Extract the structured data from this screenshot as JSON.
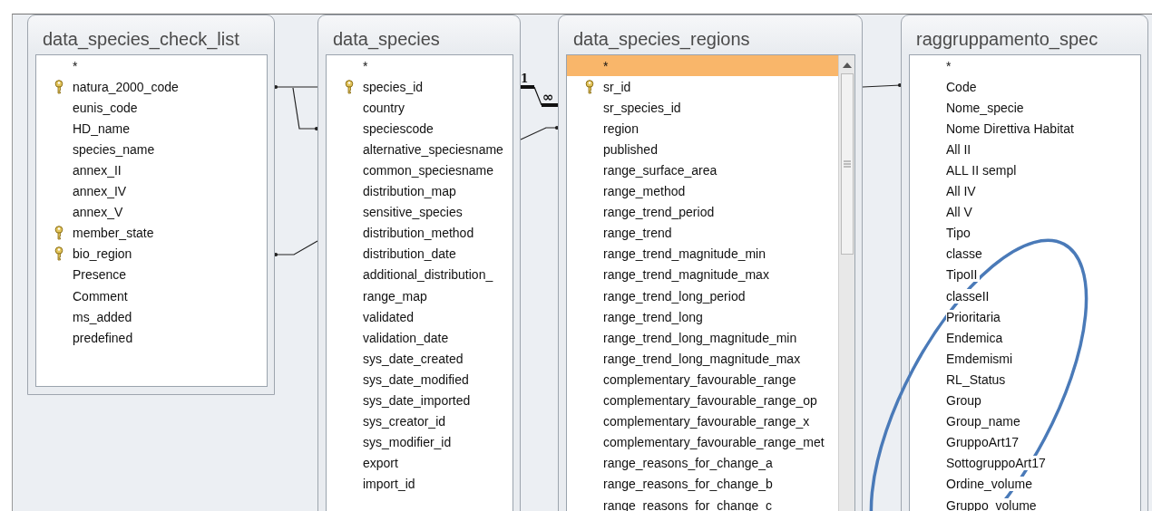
{
  "tables": [
    {
      "title": "data_species_check_list",
      "fields": [
        {
          "name": "*",
          "key": false,
          "selected": false
        },
        {
          "name": "natura_2000_code",
          "key": true,
          "selected": false
        },
        {
          "name": "eunis_code",
          "key": false,
          "selected": false
        },
        {
          "name": "HD_name",
          "key": false,
          "selected": false
        },
        {
          "name": "species_name",
          "key": false,
          "selected": false
        },
        {
          "name": "annex_II",
          "key": false,
          "selected": false
        },
        {
          "name": "annex_IV",
          "key": false,
          "selected": false
        },
        {
          "name": "annex_V",
          "key": false,
          "selected": false
        },
        {
          "name": "member_state",
          "key": true,
          "selected": false
        },
        {
          "name": "bio_region",
          "key": true,
          "selected": false
        },
        {
          "name": "Presence",
          "key": false,
          "selected": false
        },
        {
          "name": "Comment",
          "key": false,
          "selected": false
        },
        {
          "name": "ms_added",
          "key": false,
          "selected": false
        },
        {
          "name": "predefined",
          "key": false,
          "selected": false
        }
      ]
    },
    {
      "title": "data_species",
      "fields": [
        {
          "name": "*",
          "key": false,
          "selected": false
        },
        {
          "name": "species_id",
          "key": true,
          "selected": false
        },
        {
          "name": "country",
          "key": false,
          "selected": false
        },
        {
          "name": "speciescode",
          "key": false,
          "selected": false
        },
        {
          "name": "alternative_speciesname",
          "key": false,
          "selected": false
        },
        {
          "name": "common_speciesname",
          "key": false,
          "selected": false
        },
        {
          "name": "distribution_map",
          "key": false,
          "selected": false
        },
        {
          "name": "sensitive_species",
          "key": false,
          "selected": false
        },
        {
          "name": "distribution_method",
          "key": false,
          "selected": false
        },
        {
          "name": "distribution_date",
          "key": false,
          "selected": false
        },
        {
          "name": "additional_distribution_",
          "key": false,
          "selected": false
        },
        {
          "name": "range_map",
          "key": false,
          "selected": false
        },
        {
          "name": "validated",
          "key": false,
          "selected": false
        },
        {
          "name": "validation_date",
          "key": false,
          "selected": false
        },
        {
          "name": "sys_date_created",
          "key": false,
          "selected": false
        },
        {
          "name": "sys_date_modified",
          "key": false,
          "selected": false
        },
        {
          "name": "sys_date_imported",
          "key": false,
          "selected": false
        },
        {
          "name": "sys_creator_id",
          "key": false,
          "selected": false
        },
        {
          "name": "sys_modifier_id",
          "key": false,
          "selected": false
        },
        {
          "name": "export",
          "key": false,
          "selected": false
        },
        {
          "name": "import_id",
          "key": false,
          "selected": false
        }
      ]
    },
    {
      "title": "data_species_regions",
      "scrollbar": true,
      "fields": [
        {
          "name": "*",
          "key": false,
          "selected": true
        },
        {
          "name": "sr_id",
          "key": true,
          "selected": false
        },
        {
          "name": "sr_species_id",
          "key": false,
          "selected": false
        },
        {
          "name": "region",
          "key": false,
          "selected": false
        },
        {
          "name": "published",
          "key": false,
          "selected": false
        },
        {
          "name": "range_surface_area",
          "key": false,
          "selected": false
        },
        {
          "name": "range_method",
          "key": false,
          "selected": false
        },
        {
          "name": "range_trend_period",
          "key": false,
          "selected": false
        },
        {
          "name": "range_trend",
          "key": false,
          "selected": false
        },
        {
          "name": "range_trend_magnitude_min",
          "key": false,
          "selected": false
        },
        {
          "name": "range_trend_magnitude_max",
          "key": false,
          "selected": false
        },
        {
          "name": "range_trend_long_period",
          "key": false,
          "selected": false
        },
        {
          "name": "range_trend_long",
          "key": false,
          "selected": false
        },
        {
          "name": "range_trend_long_magnitude_min",
          "key": false,
          "selected": false
        },
        {
          "name": "range_trend_long_magnitude_max",
          "key": false,
          "selected": false
        },
        {
          "name": "complementary_favourable_range",
          "key": false,
          "selected": false
        },
        {
          "name": "complementary_favourable_range_op",
          "key": false,
          "selected": false
        },
        {
          "name": "complementary_favourable_range_x",
          "key": false,
          "selected": false
        },
        {
          "name": "complementary_favourable_range_met",
          "key": false,
          "selected": false
        },
        {
          "name": "range_reasons_for_change_a",
          "key": false,
          "selected": false
        },
        {
          "name": "range_reasons_for_change_b",
          "key": false,
          "selected": false
        },
        {
          "name": "range_reasons_for_change_c",
          "key": false,
          "selected": false
        }
      ]
    },
    {
      "title": "raggruppamento_spec",
      "fields": [
        {
          "name": "*",
          "key": false,
          "selected": false
        },
        {
          "name": "Code",
          "key": false,
          "selected": false
        },
        {
          "name": "Nome_specie",
          "key": false,
          "selected": false
        },
        {
          "name": "Nome Direttiva Habitat",
          "key": false,
          "selected": false
        },
        {
          "name": "All II",
          "key": false,
          "selected": false
        },
        {
          "name": "ALL II sempl",
          "key": false,
          "selected": false
        },
        {
          "name": "All IV",
          "key": false,
          "selected": false
        },
        {
          "name": "All V",
          "key": false,
          "selected": false
        },
        {
          "name": "Tipo",
          "key": false,
          "selected": false
        },
        {
          "name": "classe",
          "key": false,
          "selected": false
        },
        {
          "name": "TipoII",
          "key": false,
          "selected": false
        },
        {
          "name": "classeII",
          "key": false,
          "selected": false
        },
        {
          "name": "Prioritaria",
          "key": false,
          "selected": false
        },
        {
          "name": "Endemica",
          "key": false,
          "selected": false
        },
        {
          "name": "Emdemismi",
          "key": false,
          "selected": false
        },
        {
          "name": "RL_Status",
          "key": false,
          "selected": false
        },
        {
          "name": "Group",
          "key": false,
          "selected": false
        },
        {
          "name": "Group_name",
          "key": false,
          "selected": false
        },
        {
          "name": "GruppoArt17",
          "key": false,
          "selected": false
        },
        {
          "name": "SottogruppoArt17",
          "key": false,
          "selected": false
        },
        {
          "name": "Ordine_volume",
          "key": false,
          "selected": false
        },
        {
          "name": "Gruppo_volume",
          "key": false,
          "selected": false
        }
      ]
    }
  ],
  "relationship": {
    "one_label": "1",
    "many_label": "∞"
  }
}
